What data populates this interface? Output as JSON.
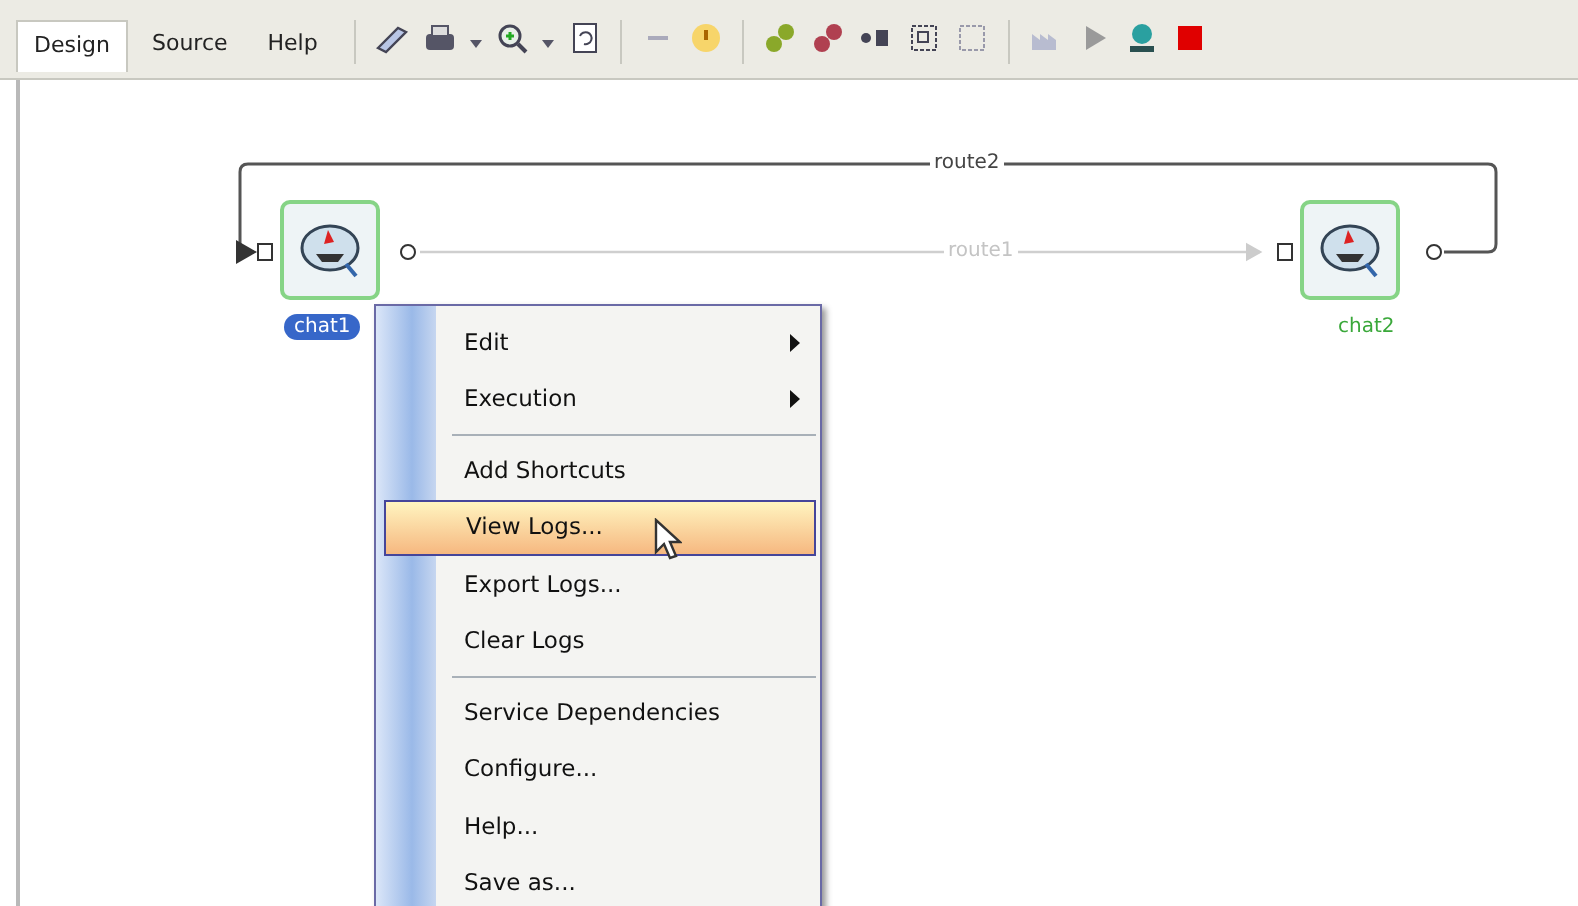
{
  "tabs": [
    {
      "label": "Design",
      "selected": true
    },
    {
      "label": "Source",
      "selected": false
    },
    {
      "label": "Help",
      "selected": false
    }
  ],
  "routes": [
    {
      "label": "route2",
      "faded": false
    },
    {
      "label": "route1",
      "faded": true
    }
  ],
  "nodes": [
    {
      "label": "chat1",
      "selected": true
    },
    {
      "label": "chat2",
      "selected": false
    }
  ],
  "context_menu": [
    {
      "label": "Edit",
      "kind": "submenu",
      "selected": false
    },
    {
      "label": "Execution",
      "kind": "submenu",
      "selected": false
    },
    {
      "kind": "separator"
    },
    {
      "label": "Add Shortcuts",
      "kind": "item",
      "selected": false
    },
    {
      "label": "View Logs...",
      "kind": "item",
      "selected": true
    },
    {
      "label": "Export Logs...",
      "kind": "item",
      "selected": false
    },
    {
      "label": "Clear Logs",
      "kind": "item",
      "selected": false
    },
    {
      "kind": "separator"
    },
    {
      "label": "Service Dependencies",
      "kind": "item",
      "selected": false
    },
    {
      "label": "Configure...",
      "kind": "item",
      "selected": false
    },
    {
      "label": "Help...",
      "kind": "item",
      "selected": false
    },
    {
      "label": "Save as...",
      "kind": "item",
      "selected": false
    }
  ]
}
